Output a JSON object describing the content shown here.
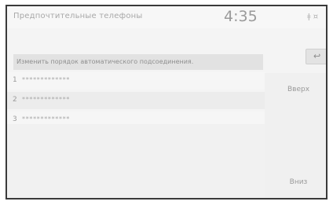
{
  "header": {
    "title": "Предпочтительные телефоны",
    "clock": "4:35",
    "status_icons": "ǂ ¤"
  },
  "instruction": "Изменить порядок автоматического подсоединения.",
  "back_glyph": "↩",
  "rows": [
    {
      "num": "1",
      "value": "*************",
      "selected": false
    },
    {
      "num": "2",
      "value": "*************",
      "selected": true
    },
    {
      "num": "3",
      "value": "*************",
      "selected": false
    }
  ],
  "buttons": {
    "up": "Вверх",
    "down": "Вниз"
  },
  "colors": {
    "selected_row": "#ececec",
    "row": "#f6f6f6"
  }
}
